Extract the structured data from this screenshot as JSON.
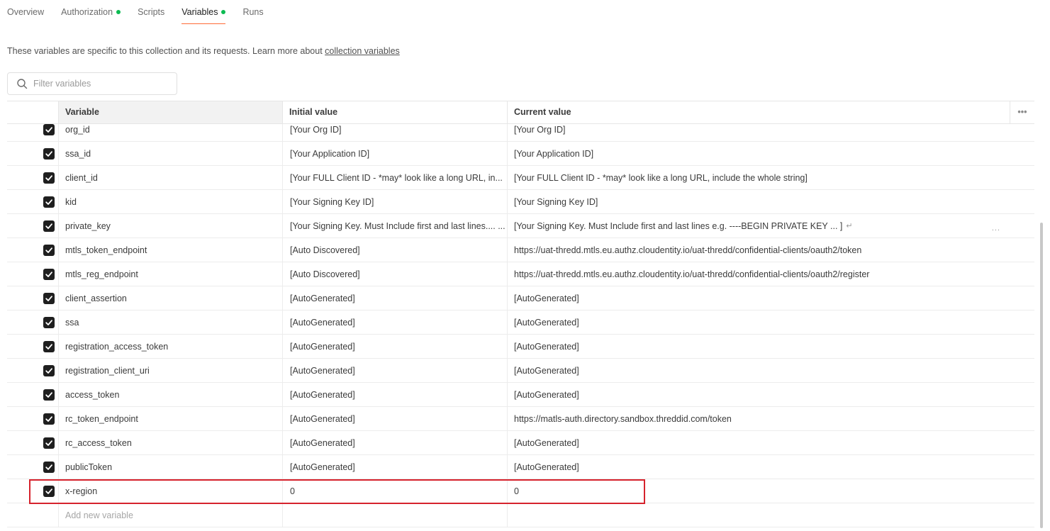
{
  "tabs": [
    {
      "label": "Overview",
      "active": false,
      "dot": false
    },
    {
      "label": "Authorization",
      "active": false,
      "dot": true
    },
    {
      "label": "Scripts",
      "active": false,
      "dot": false
    },
    {
      "label": "Variables",
      "active": true,
      "dot": true
    },
    {
      "label": "Runs",
      "active": false,
      "dot": false
    }
  ],
  "description": {
    "text": "These variables are specific to this collection and its requests. Learn more about ",
    "link": "collection variables"
  },
  "filter": {
    "placeholder": "Filter variables",
    "icon": "search-icon"
  },
  "table": {
    "headers": {
      "variable": "Variable",
      "initial": "Initial value",
      "current": "Current value",
      "more": "•••"
    },
    "rows": [
      {
        "variable": "org_id",
        "initial": "[Your Org ID]",
        "current": "[Your Org ID]",
        "checked": true
      },
      {
        "variable": "ssa_id",
        "initial": "[Your Application ID]",
        "current": "[Your Application ID]",
        "checked": true
      },
      {
        "variable": "client_id",
        "initial": "[Your FULL Client ID - *may* look like a long URL, in...",
        "current": "[Your FULL Client ID - *may* look like a long URL, include the whole string]",
        "checked": true
      },
      {
        "variable": "kid",
        "initial": "[Your Signing Key ID]",
        "current": "[Your Signing Key ID]",
        "checked": true
      },
      {
        "variable": "private_key",
        "initial": "[Your Signing Key. Must Include first and last lines.... ...",
        "current": "[Your Signing Key. Must Include first and last lines e.g. ----BEGIN PRIVATE KEY ... ]",
        "checked": true,
        "multiline": true,
        "row_more": "..."
      },
      {
        "variable": "mtls_token_endpoint",
        "initial": "[Auto Discovered]",
        "current": "https://uat-thredd.mtls.eu.authz.cloudentity.io/uat-thredd/confidential-clients/oauth2/token",
        "checked": true
      },
      {
        "variable": "mtls_reg_endpoint",
        "initial": "[Auto Discovered]",
        "current": "https://uat-thredd.mtls.eu.authz.cloudentity.io/uat-thredd/confidential-clients/oauth2/register",
        "checked": true
      },
      {
        "variable": "client_assertion",
        "initial": "[AutoGenerated]",
        "current": "[AutoGenerated]",
        "checked": true
      },
      {
        "variable": "ssa",
        "initial": "[AutoGenerated]",
        "current": "[AutoGenerated]",
        "checked": true
      },
      {
        "variable": "registration_access_token",
        "initial": "[AutoGenerated]",
        "current": "[AutoGenerated]",
        "checked": true
      },
      {
        "variable": "registration_client_uri",
        "initial": "[AutoGenerated]",
        "current": "[AutoGenerated]",
        "checked": true
      },
      {
        "variable": "access_token",
        "initial": "[AutoGenerated]",
        "current": "[AutoGenerated]",
        "checked": true
      },
      {
        "variable": "rc_token_endpoint",
        "initial": "[AutoGenerated]",
        "current": "https://matls-auth.directory.sandbox.threddid.com/token",
        "checked": true
      },
      {
        "variable": "rc_access_token",
        "initial": "[AutoGenerated]",
        "current": "[AutoGenerated]",
        "checked": true
      },
      {
        "variable": "publicToken",
        "initial": "[AutoGenerated]",
        "current": "[AutoGenerated]",
        "checked": true
      },
      {
        "variable": "x-region",
        "initial": "0",
        "current": "0",
        "checked": true,
        "highlighted": true
      }
    ],
    "add_placeholder": "Add new variable"
  },
  "colors": {
    "accent": "#ff6c37",
    "status_dot": "#0cbb52",
    "highlight": "#d6232d"
  }
}
